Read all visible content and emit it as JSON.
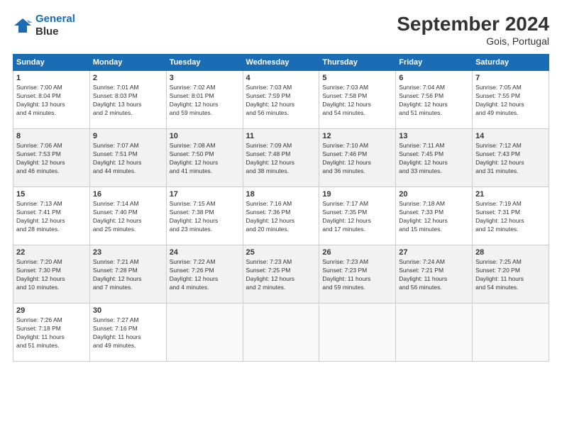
{
  "logo": {
    "line1": "General",
    "line2": "Blue"
  },
  "title": "September 2024",
  "subtitle": "Gois, Portugal",
  "headers": [
    "Sunday",
    "Monday",
    "Tuesday",
    "Wednesday",
    "Thursday",
    "Friday",
    "Saturday"
  ],
  "weeks": [
    [
      {
        "day": "1",
        "info": "Sunrise: 7:00 AM\nSunset: 8:04 PM\nDaylight: 13 hours\nand 4 minutes."
      },
      {
        "day": "2",
        "info": "Sunrise: 7:01 AM\nSunset: 8:03 PM\nDaylight: 13 hours\nand 2 minutes."
      },
      {
        "day": "3",
        "info": "Sunrise: 7:02 AM\nSunset: 8:01 PM\nDaylight: 12 hours\nand 59 minutes."
      },
      {
        "day": "4",
        "info": "Sunrise: 7:03 AM\nSunset: 7:59 PM\nDaylight: 12 hours\nand 56 minutes."
      },
      {
        "day": "5",
        "info": "Sunrise: 7:03 AM\nSunset: 7:58 PM\nDaylight: 12 hours\nand 54 minutes."
      },
      {
        "day": "6",
        "info": "Sunrise: 7:04 AM\nSunset: 7:56 PM\nDaylight: 12 hours\nand 51 minutes."
      },
      {
        "day": "7",
        "info": "Sunrise: 7:05 AM\nSunset: 7:55 PM\nDaylight: 12 hours\nand 49 minutes."
      }
    ],
    [
      {
        "day": "8",
        "info": "Sunrise: 7:06 AM\nSunset: 7:53 PM\nDaylight: 12 hours\nand 46 minutes."
      },
      {
        "day": "9",
        "info": "Sunrise: 7:07 AM\nSunset: 7:51 PM\nDaylight: 12 hours\nand 44 minutes."
      },
      {
        "day": "10",
        "info": "Sunrise: 7:08 AM\nSunset: 7:50 PM\nDaylight: 12 hours\nand 41 minutes."
      },
      {
        "day": "11",
        "info": "Sunrise: 7:09 AM\nSunset: 7:48 PM\nDaylight: 12 hours\nand 38 minutes."
      },
      {
        "day": "12",
        "info": "Sunrise: 7:10 AM\nSunset: 7:46 PM\nDaylight: 12 hours\nand 36 minutes."
      },
      {
        "day": "13",
        "info": "Sunrise: 7:11 AM\nSunset: 7:45 PM\nDaylight: 12 hours\nand 33 minutes."
      },
      {
        "day": "14",
        "info": "Sunrise: 7:12 AM\nSunset: 7:43 PM\nDaylight: 12 hours\nand 31 minutes."
      }
    ],
    [
      {
        "day": "15",
        "info": "Sunrise: 7:13 AM\nSunset: 7:41 PM\nDaylight: 12 hours\nand 28 minutes."
      },
      {
        "day": "16",
        "info": "Sunrise: 7:14 AM\nSunset: 7:40 PM\nDaylight: 12 hours\nand 25 minutes."
      },
      {
        "day": "17",
        "info": "Sunrise: 7:15 AM\nSunset: 7:38 PM\nDaylight: 12 hours\nand 23 minutes."
      },
      {
        "day": "18",
        "info": "Sunrise: 7:16 AM\nSunset: 7:36 PM\nDaylight: 12 hours\nand 20 minutes."
      },
      {
        "day": "19",
        "info": "Sunrise: 7:17 AM\nSunset: 7:35 PM\nDaylight: 12 hours\nand 17 minutes."
      },
      {
        "day": "20",
        "info": "Sunrise: 7:18 AM\nSunset: 7:33 PM\nDaylight: 12 hours\nand 15 minutes."
      },
      {
        "day": "21",
        "info": "Sunrise: 7:19 AM\nSunset: 7:31 PM\nDaylight: 12 hours\nand 12 minutes."
      }
    ],
    [
      {
        "day": "22",
        "info": "Sunrise: 7:20 AM\nSunset: 7:30 PM\nDaylight: 12 hours\nand 10 minutes."
      },
      {
        "day": "23",
        "info": "Sunrise: 7:21 AM\nSunset: 7:28 PM\nDaylight: 12 hours\nand 7 minutes."
      },
      {
        "day": "24",
        "info": "Sunrise: 7:22 AM\nSunset: 7:26 PM\nDaylight: 12 hours\nand 4 minutes."
      },
      {
        "day": "25",
        "info": "Sunrise: 7:23 AM\nSunset: 7:25 PM\nDaylight: 12 hours\nand 2 minutes."
      },
      {
        "day": "26",
        "info": "Sunrise: 7:23 AM\nSunset: 7:23 PM\nDaylight: 11 hours\nand 59 minutes."
      },
      {
        "day": "27",
        "info": "Sunrise: 7:24 AM\nSunset: 7:21 PM\nDaylight: 11 hours\nand 56 minutes."
      },
      {
        "day": "28",
        "info": "Sunrise: 7:25 AM\nSunset: 7:20 PM\nDaylight: 11 hours\nand 54 minutes."
      }
    ],
    [
      {
        "day": "29",
        "info": "Sunrise: 7:26 AM\nSunset: 7:18 PM\nDaylight: 11 hours\nand 51 minutes."
      },
      {
        "day": "30",
        "info": "Sunrise: 7:27 AM\nSunset: 7:16 PM\nDaylight: 11 hours\nand 49 minutes."
      },
      {
        "day": "",
        "info": ""
      },
      {
        "day": "",
        "info": ""
      },
      {
        "day": "",
        "info": ""
      },
      {
        "day": "",
        "info": ""
      },
      {
        "day": "",
        "info": ""
      }
    ]
  ]
}
